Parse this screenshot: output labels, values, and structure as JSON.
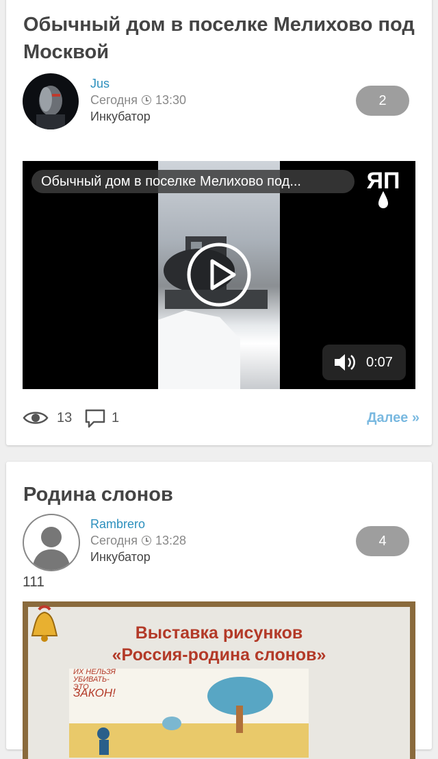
{
  "posts": [
    {
      "title": "Обычный дом в поселке Мелихово под Москвой",
      "author": "Jus",
      "date": "Сегодня",
      "time": "13:30",
      "category": "Инкубатор",
      "rating": "2",
      "video": {
        "title": "Обычный дом в поселке Мелихово под...",
        "logo": "ЯП",
        "duration": "0:07"
      },
      "views": "13",
      "comments": "1",
      "more_label": "Далее »"
    },
    {
      "title": "Родина слонов",
      "author": "Rambrero",
      "date": "Сегодня",
      "time": "13:28",
      "category": "Инкубатор",
      "rating": "4",
      "excerpt": "111",
      "image": {
        "line1": "Выставка рисунков",
        "line2": "«Россия-родина слонов»",
        "scrawl": "ИХ НЕЛЬЗЯ УБИВАТЬ- ЭТО",
        "scrawl2": "ЗАКОН!"
      }
    }
  ],
  "icons": {
    "eye": "eye-icon",
    "comment": "comment-bubble-icon",
    "clock": "clock-icon",
    "play": "play-icon",
    "volume": "volume-icon"
  }
}
